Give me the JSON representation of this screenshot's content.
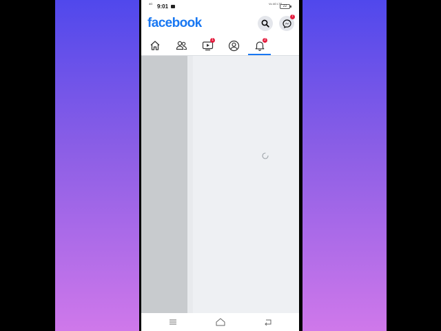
{
  "status_bar": {
    "network": "4G",
    "time": "9:01",
    "signal": "Vo 4G LTE",
    "battery": "22"
  },
  "header": {
    "logo": "facebook",
    "messenger_badge": "7"
  },
  "tabs": [
    {
      "name": "home",
      "icon": "home-icon",
      "badge": ""
    },
    {
      "name": "friends",
      "icon": "friends-icon",
      "badge": ""
    },
    {
      "name": "watch",
      "icon": "video-icon",
      "badge": "1"
    },
    {
      "name": "profile",
      "icon": "profile-icon",
      "badge": ""
    },
    {
      "name": "notifications",
      "icon": "bell-icon",
      "badge": "2",
      "active": true
    }
  ],
  "colors": {
    "brand": "#1877f2",
    "badge": "#e41e3f",
    "background_gradient_top": "#5048ec",
    "background_gradient_bottom": "#cf78ea"
  },
  "system_nav": {
    "icons": [
      "menu-icon",
      "home-outline-icon",
      "back-icon"
    ]
  }
}
